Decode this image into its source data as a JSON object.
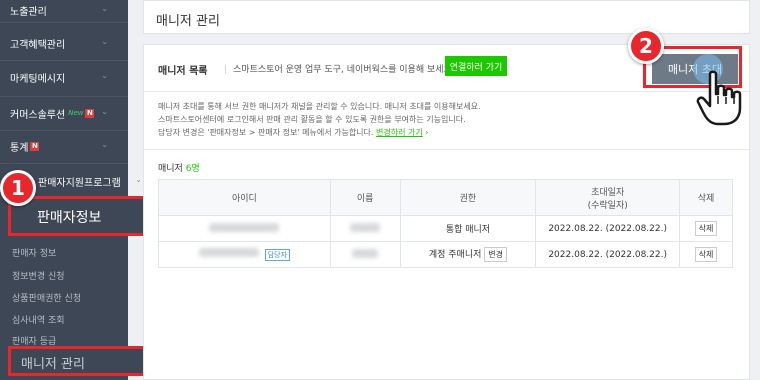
{
  "sidebar": {
    "items": [
      {
        "label": "노출관리"
      },
      {
        "label": "고객혜택관리"
      },
      {
        "label": "마케팅메시지"
      },
      {
        "label": "커머스솔루션",
        "new_tag": "New"
      },
      {
        "label": "통계"
      },
      {
        "label": "판매자지원프로그램"
      }
    ],
    "section_label": "판매자정보",
    "sub_items": [
      {
        "label": "판매자 정보"
      },
      {
        "label": "정보변경 신청"
      },
      {
        "label": "상품판매권한 신청"
      },
      {
        "label": "심사내역 조회"
      },
      {
        "label": "판매자 등급"
      },
      {
        "label": "매니저 관리"
      }
    ],
    "n_badge": "N"
  },
  "callouts": {
    "one": "1",
    "two": "2"
  },
  "page": {
    "title": "매니저 관리",
    "section_title": "매니저 목록",
    "section_desc": "스마트스토어 운영 업무 도구, 네이버웍스를 이용해 보세요.",
    "connect_label": "연결하러 가기",
    "invite_label": "매니저 초대",
    "info_lines": [
      "매니저 초대를 통해 서브 권한 매니저가 채널을 관리할 수 있습니다. 매니저 초대를 이용해보세요.",
      "스마트스토어센터에 로그인해서 판매 관리 활동을 할 수 있도록 권한을 부여하는 기능입니다.",
      "담당자 변경은 '판매자정보 > 판매자 정보' 메뉴에서 가능합니다."
    ],
    "info_link": "변경하러 가기",
    "count_prefix": "매니저",
    "count_value": "6명"
  },
  "table": {
    "headers": [
      "아이디",
      "이름",
      "권한",
      "초대일자\n(수락일자)",
      "삭제"
    ],
    "rows": [
      {
        "role": "통합 매니저",
        "date": "2022.08.22. (2022.08.22.)",
        "delete": "삭제",
        "tag": "",
        "role_btn": ""
      },
      {
        "role": "계정 주매니저",
        "date": "2022.08.22. (2022.08.22.)",
        "delete": "삭제",
        "tag": "담당자",
        "role_btn": "변경"
      }
    ]
  },
  "colors": {
    "accent_green": "#1ec800",
    "callout_red": "#e8262b",
    "sidebar_bg": "#3e4756"
  }
}
